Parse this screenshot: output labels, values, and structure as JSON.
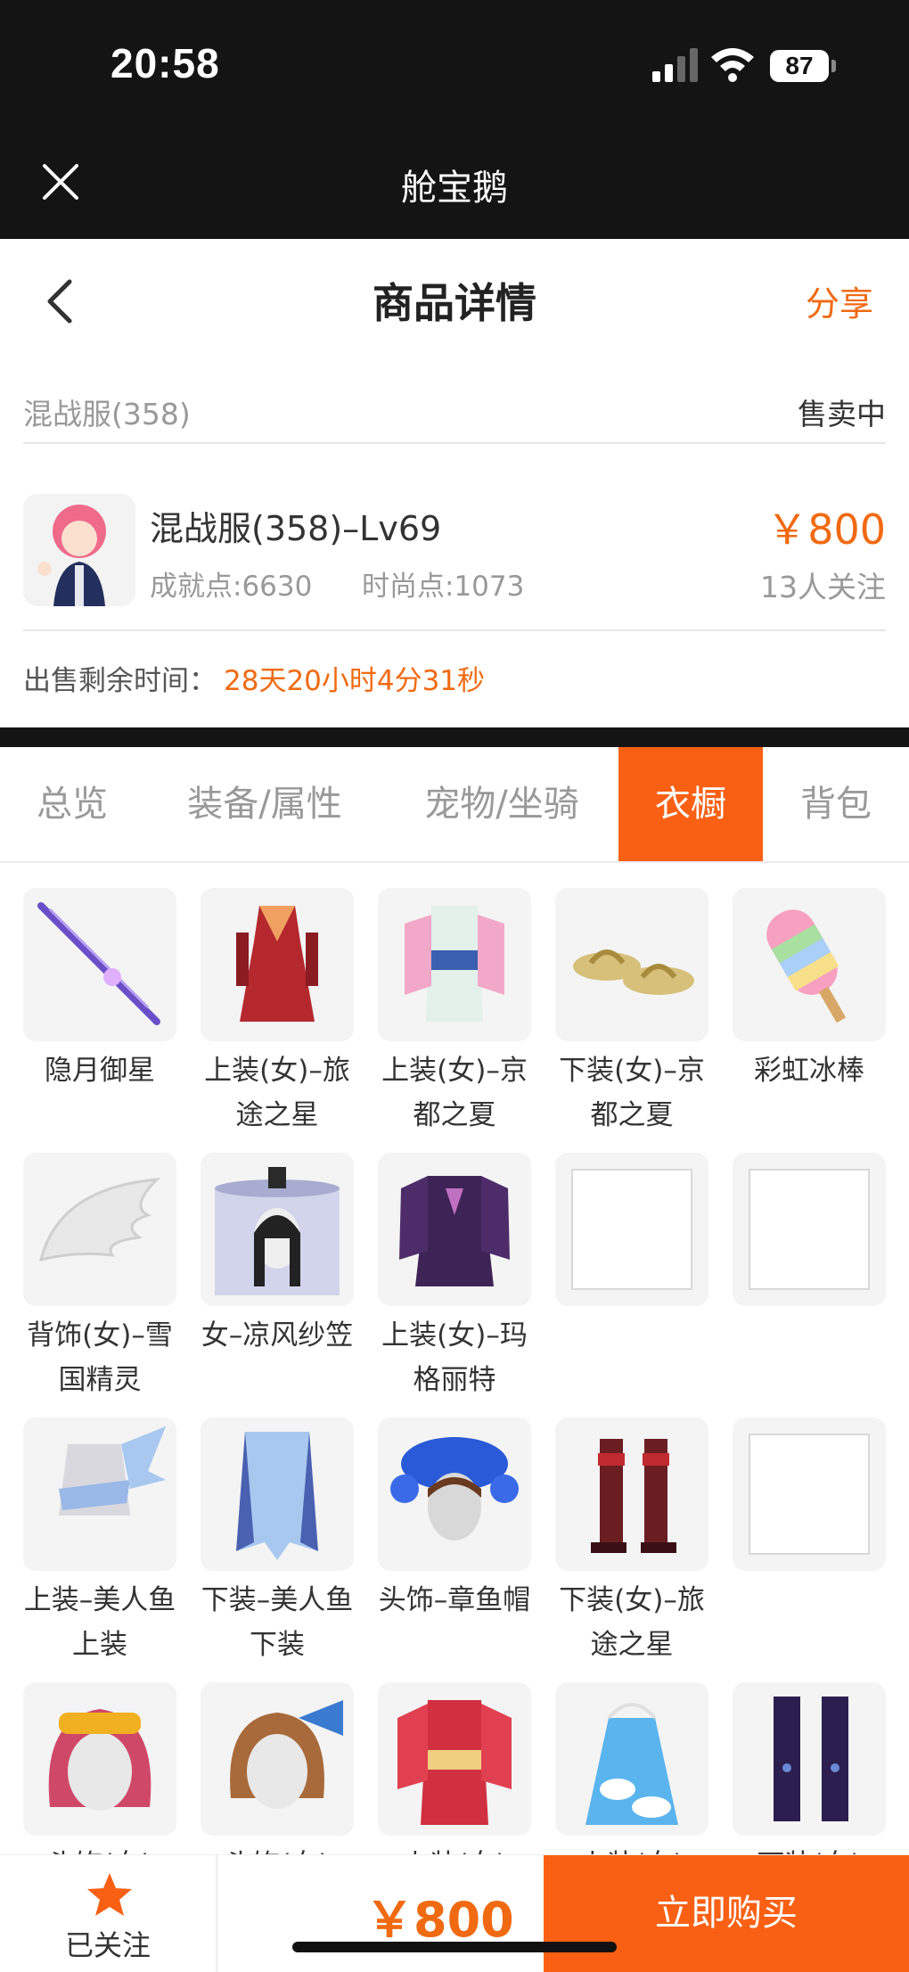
{
  "status_bar": {
    "time": "20:58",
    "battery": "87"
  },
  "app_bar": {
    "title": "舱宝鹅",
    "close_icon": "close-icon"
  },
  "nav": {
    "title": "商品详情",
    "share": "分享",
    "back_icon": "chevron-left-icon"
  },
  "server": {
    "name": "混战服(358)",
    "status": "售卖中"
  },
  "product": {
    "name": "混战服(358)–Lv69",
    "achievement": "成就点:6630",
    "fashion": "时尚点:1073",
    "price": "￥800",
    "followers": "13人关注"
  },
  "remaining": {
    "label": "出售剩余时间：",
    "value": "28天20小时4分31秒"
  },
  "tabs": [
    {
      "label": "总览"
    },
    {
      "label": "装备/属性"
    },
    {
      "label": "宠物/坐骑"
    },
    {
      "label": "衣橱",
      "active": true
    },
    {
      "label": "背包"
    }
  ],
  "wardrobe": [
    {
      "caption": "隐月御星",
      "icon": "sword-icon"
    },
    {
      "caption": "上装(女)–旅途之星",
      "icon": "red-dress-icon"
    },
    {
      "caption": "上装(女)–京都之夏",
      "icon": "kimono-icon"
    },
    {
      "caption": "下装(女)–京都之夏",
      "icon": "sandals-icon"
    },
    {
      "caption": "彩虹冰棒",
      "icon": "popsicle-icon"
    },
    {
      "caption": "背饰(女)–雪国精灵",
      "icon": "wing-icon"
    },
    {
      "caption": "女–凉风纱笠",
      "icon": "veil-hat-icon"
    },
    {
      "caption": "上装(女)–玛格丽特",
      "icon": "purple-outfit-icon"
    },
    {
      "caption": "",
      "icon": "empty-slot"
    },
    {
      "caption": "",
      "icon": "empty-slot"
    },
    {
      "caption": "上装–美人鱼上装",
      "icon": "mermaid-top-icon"
    },
    {
      "caption": "下装–美人鱼下装",
      "icon": "mermaid-bottom-icon"
    },
    {
      "caption": "头饰–章鱼帽",
      "icon": "octopus-hat-icon"
    },
    {
      "caption": "下装(女)–旅途之星",
      "icon": "boots-icon"
    },
    {
      "caption": "",
      "icon": "empty-slot"
    },
    {
      "caption": "头饰(女)",
      "icon": "goggles-hair-icon"
    },
    {
      "caption": "头饰(女)",
      "icon": "fan-hair-icon"
    },
    {
      "caption": "上装(女)",
      "icon": "red-kimono-icon"
    },
    {
      "caption": "上装(女)",
      "icon": "cloud-dress-icon"
    },
    {
      "caption": "下装(女)",
      "icon": "purple-boots-icon"
    }
  ],
  "bottom_bar": {
    "follow_label": "已关注",
    "price": "￥800",
    "buy_label": "立即购买"
  },
  "colors": {
    "accent": "#f96014",
    "price": "#f06a12",
    "dark": "#141414"
  }
}
